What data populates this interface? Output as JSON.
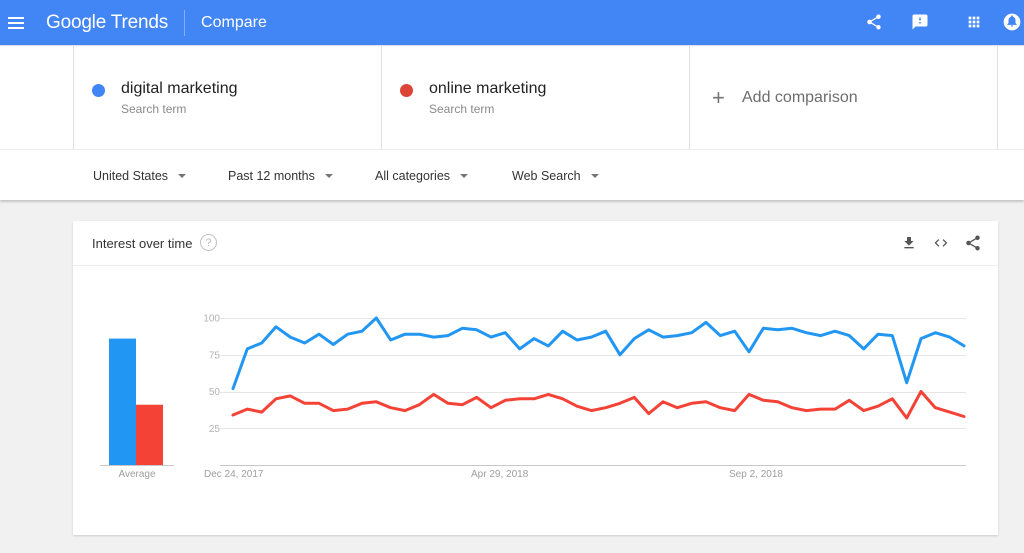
{
  "appbar": {
    "app_name": "Google Trends",
    "page_name": "Compare",
    "icons": [
      "menu-icon",
      "share-icon",
      "feedback-icon",
      "apps-grid-icon",
      "notifications-icon"
    ],
    "color": "#4285f4"
  },
  "terms": [
    {
      "name": "digital marketing",
      "sub": "Search term",
      "color": "#4285f4"
    },
    {
      "name": "online marketing",
      "sub": "Search term",
      "color": "#db4437"
    }
  ],
  "add_comparison": {
    "icon": "+",
    "label": "Add comparison"
  },
  "filters": [
    {
      "label": "United States"
    },
    {
      "label": "Past 12 months"
    },
    {
      "label": "All categories"
    },
    {
      "label": "Web Search"
    }
  ],
  "card": {
    "title": "Interest over time",
    "help_icon": "?",
    "actions": [
      "download-icon",
      "embed-icon",
      "share-icon"
    ]
  },
  "chart_data": [
    {
      "type": "bar",
      "title": "Average",
      "categories": [
        "Average"
      ],
      "series": [
        {
          "name": "digital marketing",
          "values": [
            86
          ],
          "color": "#2196f3"
        },
        {
          "name": "online marketing",
          "values": [
            41
          ],
          "color": "#f44336"
        }
      ],
      "xlabel": "Average",
      "ylim": [
        0,
        100
      ]
    },
    {
      "type": "line",
      "title": "Interest over time",
      "x_tick_labels": [
        "Dec 24, 2017",
        "Apr 29, 2018",
        "Sep 2, 2018"
      ],
      "x_tick_indices": [
        0,
        18,
        36
      ],
      "y_ticks": [
        25,
        50,
        75,
        100
      ],
      "ylim": [
        0,
        100
      ],
      "grid": true,
      "series": [
        {
          "name": "digital marketing",
          "color": "#2196f3",
          "values": [
            52,
            79,
            83,
            94,
            87,
            83,
            89,
            82,
            89,
            91,
            100,
            85,
            89,
            89,
            87,
            88,
            93,
            92,
            87,
            90,
            79,
            86,
            81,
            91,
            85,
            87,
            91,
            75,
            86,
            92,
            87,
            88,
            90,
            97,
            88,
            91,
            77,
            93,
            92,
            93,
            90,
            88,
            91,
            88,
            79,
            89,
            88,
            56,
            86,
            90,
            87,
            81
          ]
        },
        {
          "name": "online marketing",
          "color": "#f44336",
          "values": [
            34,
            38,
            36,
            45,
            47,
            42,
            42,
            37,
            38,
            42,
            43,
            39,
            37,
            41,
            48,
            42,
            41,
            46,
            39,
            44,
            45,
            45,
            48,
            45,
            40,
            37,
            39,
            42,
            46,
            35,
            43,
            39,
            42,
            43,
            39,
            37,
            48,
            44,
            43,
            39,
            37,
            38,
            38,
            44,
            37,
            40,
            45,
            32,
            50,
            39,
            36,
            33
          ]
        }
      ]
    }
  ]
}
